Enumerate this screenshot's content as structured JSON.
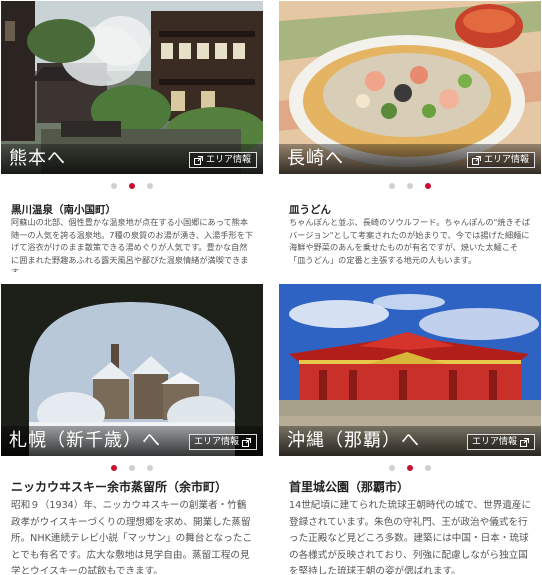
{
  "cards": [
    {
      "area": "熊本へ",
      "area_link": "エリア情報",
      "spot": "黒川温泉（南小国町）",
      "description": "阿蘇山の北部、個性豊かな温泉地が点在する小国郷にあって熊本随一の人気を誇る温泉地。7種の泉質のお湯が湧き、入湯手形を下げて浴衣がけのまま散策できる湯めぐりが人気です。豊かな自然に囲まれた野趣あふれる露天風呂や鄙びた温泉情緒が満喫できます。",
      "carousel_active": 2,
      "photo_icon": "hot-spring-village-photo"
    },
    {
      "area": "長崎へ",
      "area_link": "エリア情報",
      "spot": "皿うどん",
      "description": "ちゃんぽんと並ぶ、長崎のソウルフード。ちゃんぽんの\"焼きそばバージョン\"として考案されたのが始まりで、今では揚げた細麺に海鮮や野菜のあんを乗せたものが有名ですが、焼いた太麺こそ「皿うどん」の定番と主張する地元の人もいます。",
      "carousel_active": 3,
      "photo_icon": "sara-udon-photo"
    },
    {
      "area": "札幌（新千歳）へ",
      "area_link": "エリア情報",
      "spot": "ニッカウヰスキー余市蒸留所（余市町）",
      "description": "昭和９（1934）年、ニッカウヰスキーの創業者・竹鶴政孝がウイスキーづくりの理想郷を求め、開業した蒸留所。NHK連続テレビ小説「マッサン」の舞台となったことでも有名です。広大な敷地は見学自由。蒸留工程の見学とウイスキーの試飲もできます。",
      "carousel_active": 1,
      "photo_icon": "distillery-snow-photo"
    },
    {
      "area": "沖縄（那覇）へ",
      "area_link": "エリア情報",
      "spot": "首里城公園（那覇市）",
      "description": "14世紀頃に建てられた琉球王朝時代の城で、世界遺産に登録されています。朱色の守礼門、王が政治や儀式を行った正殿など見どころ多数。建築には中国・日本・琉球の各様式が反映されており、列強に配慮しながら独立国を堅持した琉球王朝の姿が偲ばれます。",
      "carousel_active": 2,
      "photo_icon": "shuri-castle-photo"
    }
  ],
  "colors": {
    "accent": "#c8102e",
    "dot_inactive": "#cfcfcf",
    "text_dark": "#222222",
    "text_body": "#555555"
  }
}
